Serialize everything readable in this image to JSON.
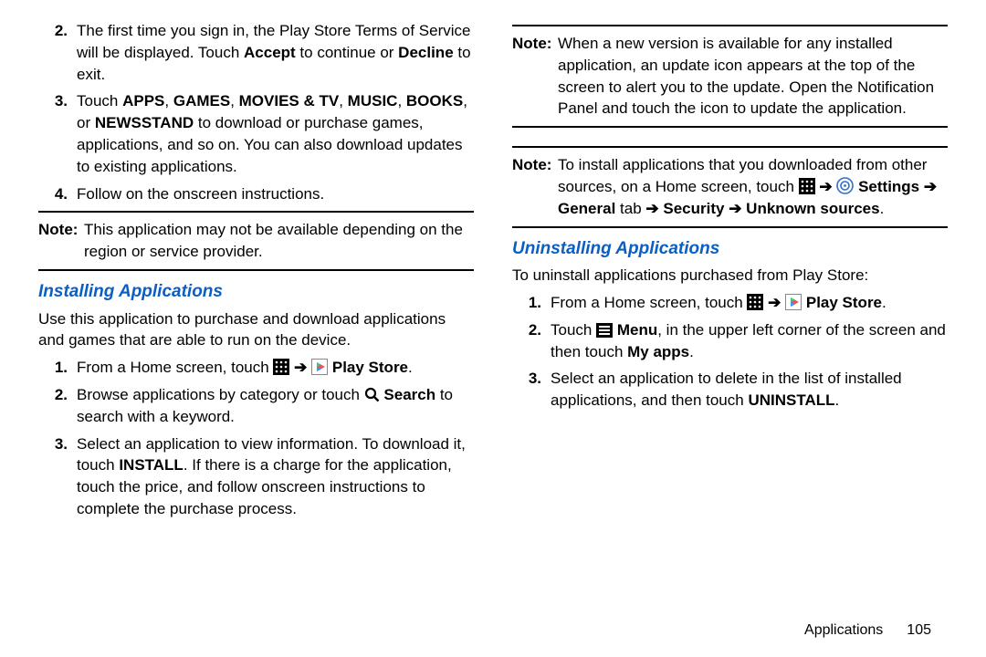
{
  "left": {
    "step2_pre": "The first time you sign in, the Play Store Terms of Service will be displayed. Touch ",
    "step2_accept": "Accept",
    "step2_mid": " to continue or ",
    "step2_decline": "Decline",
    "step2_post": " to exit.",
    "step3_pre": "Touch ",
    "step3_apps": "APPS",
    "step3_games": "GAMES",
    "step3_movies": "MOVIES & TV",
    "step3_music": "MUSIC",
    "step3_books": "BOOKS",
    "step3_or": ", or ",
    "step3_newsstand": "NEWSSTAND",
    "step3_post": " to download or purchase games, applications, and so on. You can also download updates to existing applications.",
    "step4": "Follow on the onscreen instructions.",
    "note1_lbl": "Note:",
    "note1_txt": "This application may not be available depending on the region or service provider.",
    "h_install": "Installing Applications",
    "install_intro": "Use this application to purchase and download applications and games that are able to run on the device.",
    "i1_pre": "From a Home screen, touch ",
    "i1_play": "Play Store",
    "i1_post": ".",
    "i2_pre": "Browse applications by category or touch ",
    "i2_search": "Search",
    "i2_post": " to search with a keyword.",
    "i3_pre": "Select an application to view information. To download it, touch ",
    "i3_install": "INSTALL",
    "i3_post": ". If there is a charge for the application, touch the price, and follow onscreen instructions to complete the purchase process."
  },
  "right": {
    "note2_lbl": "Note:",
    "note2_txt": "When a new version is available for any installed application, an update icon appears at the top of the screen to alert you to the update. Open the Notification Panel and touch the icon to update the application.",
    "note3_lbl": "Note:",
    "note3_pre": "To install applications that you downloaded from other sources, on a Home screen, touch ",
    "note3_settings": "Settings",
    "note3_arrow": " ➔ ",
    "note3_general": "General",
    "note3_tab": " tab ",
    "note3_security": "Security",
    "note3_unknown": "Unknown sources",
    "note3_end": ".",
    "h_uninstall": "Uninstalling Applications",
    "u_intro": "To uninstall applications purchased from Play Store:",
    "u1_pre": "From a Home screen, touch ",
    "u1_play": "Play Store",
    "u1_post": ".",
    "u2_pre": "Touch ",
    "u2_menu": "Menu",
    "u2_mid": ", in the upper left corner of the screen and then touch ",
    "u2_myapps": "My apps",
    "u2_post": ".",
    "u3_pre": "Select an application to delete in the list of installed applications, and then touch ",
    "u3_uninstall": "UNINSTALL",
    "u3_post": "."
  },
  "footer": {
    "section": "Applications",
    "page": "105"
  },
  "nums": {
    "n1": "1.",
    "n2": "2.",
    "n3": "3.",
    "n4": "4."
  },
  "sym": {
    "comma_sp": ", ",
    "arrow": " ➔ "
  }
}
